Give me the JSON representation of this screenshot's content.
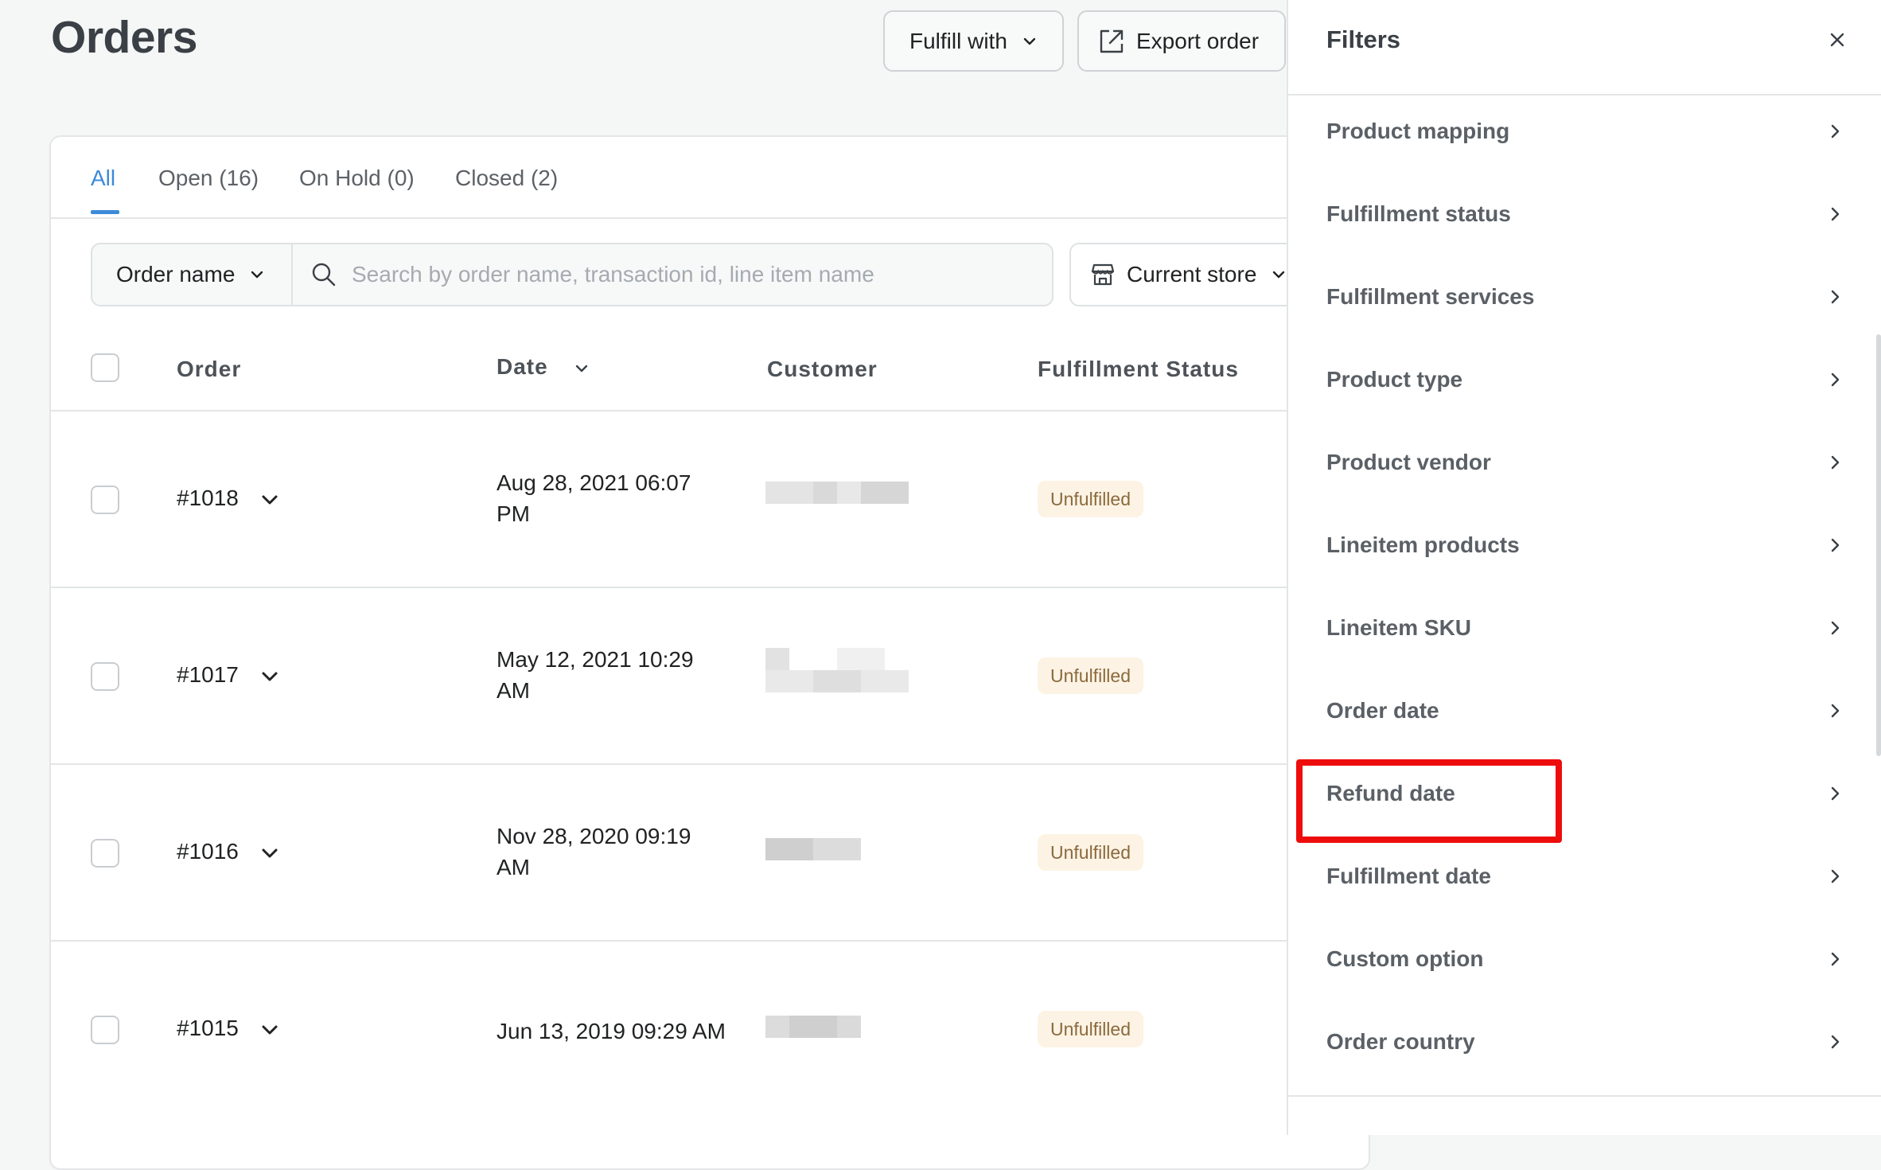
{
  "header": {
    "title": "Orders",
    "fulfill_label": "Fulfill with",
    "export_label": "Export order"
  },
  "tabs": [
    {
      "label": "All"
    },
    {
      "label": "Open (16)"
    },
    {
      "label": "On Hold (0)"
    },
    {
      "label": "Closed (2)"
    }
  ],
  "filters": {
    "order_select": "Order name",
    "search_placeholder": "Search by order name, transaction id, line item name",
    "store_select": "Current store"
  },
  "table": {
    "columns": [
      "Order",
      "Date",
      "Customer",
      "Fulfillment Status"
    ],
    "rows": [
      {
        "order": "#1018",
        "date": "Aug 28, 2021 06:07 PM",
        "status": "Unfulfilled"
      },
      {
        "order": "#1017",
        "date": "May 12, 2021 10:29 AM",
        "status": "Unfulfilled"
      },
      {
        "order": "#1016",
        "date": "Nov 28, 2020 09:19 AM",
        "status": "Unfulfilled"
      },
      {
        "order": "#1015",
        "date": "Jun 13, 2019 09:29 AM",
        "status": "Unfulfilled"
      }
    ]
  },
  "panel": {
    "title": "Filters",
    "items": [
      {
        "label": "Product mapping"
      },
      {
        "label": "Fulfillment status"
      },
      {
        "label": "Fulfillment services"
      },
      {
        "label": "Product type"
      },
      {
        "label": "Product vendor"
      },
      {
        "label": "Lineitem products"
      },
      {
        "label": "Lineitem SKU"
      },
      {
        "label": "Order date"
      },
      {
        "label": "Refund date"
      },
      {
        "label": "Fulfillment date"
      },
      {
        "label": "Custom option"
      },
      {
        "label": "Order country"
      }
    ]
  },
  "colors": {
    "accent": "#3d8bd8",
    "highlight": "#ee0d0d",
    "badge_bg": "#fdf3e4"
  }
}
